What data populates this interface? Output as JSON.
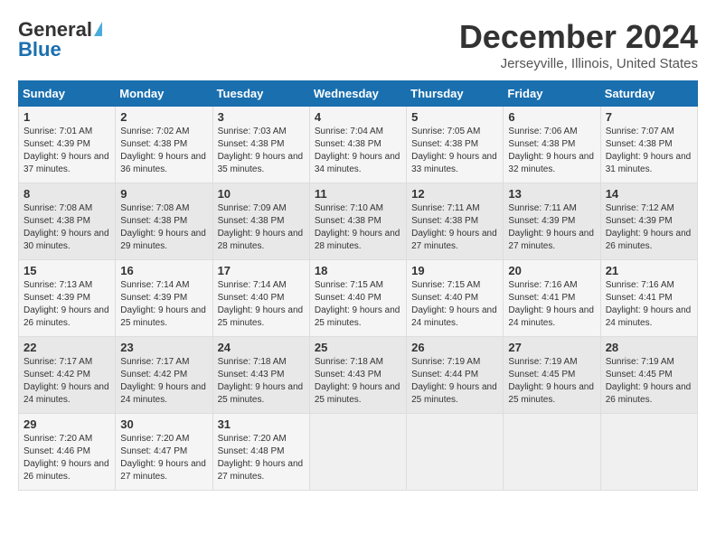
{
  "logo": {
    "general": "General",
    "blue": "Blue"
  },
  "title": "December 2024",
  "location": "Jerseyville, Illinois, United States",
  "days_of_week": [
    "Sunday",
    "Monday",
    "Tuesday",
    "Wednesday",
    "Thursday",
    "Friday",
    "Saturday"
  ],
  "weeks": [
    [
      {
        "day": "1",
        "sunrise": "Sunrise: 7:01 AM",
        "sunset": "Sunset: 4:39 PM",
        "daylight": "Daylight: 9 hours and 37 minutes."
      },
      {
        "day": "2",
        "sunrise": "Sunrise: 7:02 AM",
        "sunset": "Sunset: 4:38 PM",
        "daylight": "Daylight: 9 hours and 36 minutes."
      },
      {
        "day": "3",
        "sunrise": "Sunrise: 7:03 AM",
        "sunset": "Sunset: 4:38 PM",
        "daylight": "Daylight: 9 hours and 35 minutes."
      },
      {
        "day": "4",
        "sunrise": "Sunrise: 7:04 AM",
        "sunset": "Sunset: 4:38 PM",
        "daylight": "Daylight: 9 hours and 34 minutes."
      },
      {
        "day": "5",
        "sunrise": "Sunrise: 7:05 AM",
        "sunset": "Sunset: 4:38 PM",
        "daylight": "Daylight: 9 hours and 33 minutes."
      },
      {
        "day": "6",
        "sunrise": "Sunrise: 7:06 AM",
        "sunset": "Sunset: 4:38 PM",
        "daylight": "Daylight: 9 hours and 32 minutes."
      },
      {
        "day": "7",
        "sunrise": "Sunrise: 7:07 AM",
        "sunset": "Sunset: 4:38 PM",
        "daylight": "Daylight: 9 hours and 31 minutes."
      }
    ],
    [
      {
        "day": "8",
        "sunrise": "Sunrise: 7:08 AM",
        "sunset": "Sunset: 4:38 PM",
        "daylight": "Daylight: 9 hours and 30 minutes."
      },
      {
        "day": "9",
        "sunrise": "Sunrise: 7:08 AM",
        "sunset": "Sunset: 4:38 PM",
        "daylight": "Daylight: 9 hours and 29 minutes."
      },
      {
        "day": "10",
        "sunrise": "Sunrise: 7:09 AM",
        "sunset": "Sunset: 4:38 PM",
        "daylight": "Daylight: 9 hours and 28 minutes."
      },
      {
        "day": "11",
        "sunrise": "Sunrise: 7:10 AM",
        "sunset": "Sunset: 4:38 PM",
        "daylight": "Daylight: 9 hours and 28 minutes."
      },
      {
        "day": "12",
        "sunrise": "Sunrise: 7:11 AM",
        "sunset": "Sunset: 4:38 PM",
        "daylight": "Daylight: 9 hours and 27 minutes."
      },
      {
        "day": "13",
        "sunrise": "Sunrise: 7:11 AM",
        "sunset": "Sunset: 4:39 PM",
        "daylight": "Daylight: 9 hours and 27 minutes."
      },
      {
        "day": "14",
        "sunrise": "Sunrise: 7:12 AM",
        "sunset": "Sunset: 4:39 PM",
        "daylight": "Daylight: 9 hours and 26 minutes."
      }
    ],
    [
      {
        "day": "15",
        "sunrise": "Sunrise: 7:13 AM",
        "sunset": "Sunset: 4:39 PM",
        "daylight": "Daylight: 9 hours and 26 minutes."
      },
      {
        "day": "16",
        "sunrise": "Sunrise: 7:14 AM",
        "sunset": "Sunset: 4:39 PM",
        "daylight": "Daylight: 9 hours and 25 minutes."
      },
      {
        "day": "17",
        "sunrise": "Sunrise: 7:14 AM",
        "sunset": "Sunset: 4:40 PM",
        "daylight": "Daylight: 9 hours and 25 minutes."
      },
      {
        "day": "18",
        "sunrise": "Sunrise: 7:15 AM",
        "sunset": "Sunset: 4:40 PM",
        "daylight": "Daylight: 9 hours and 25 minutes."
      },
      {
        "day": "19",
        "sunrise": "Sunrise: 7:15 AM",
        "sunset": "Sunset: 4:40 PM",
        "daylight": "Daylight: 9 hours and 24 minutes."
      },
      {
        "day": "20",
        "sunrise": "Sunrise: 7:16 AM",
        "sunset": "Sunset: 4:41 PM",
        "daylight": "Daylight: 9 hours and 24 minutes."
      },
      {
        "day": "21",
        "sunrise": "Sunrise: 7:16 AM",
        "sunset": "Sunset: 4:41 PM",
        "daylight": "Daylight: 9 hours and 24 minutes."
      }
    ],
    [
      {
        "day": "22",
        "sunrise": "Sunrise: 7:17 AM",
        "sunset": "Sunset: 4:42 PM",
        "daylight": "Daylight: 9 hours and 24 minutes."
      },
      {
        "day": "23",
        "sunrise": "Sunrise: 7:17 AM",
        "sunset": "Sunset: 4:42 PM",
        "daylight": "Daylight: 9 hours and 24 minutes."
      },
      {
        "day": "24",
        "sunrise": "Sunrise: 7:18 AM",
        "sunset": "Sunset: 4:43 PM",
        "daylight": "Daylight: 9 hours and 25 minutes."
      },
      {
        "day": "25",
        "sunrise": "Sunrise: 7:18 AM",
        "sunset": "Sunset: 4:43 PM",
        "daylight": "Daylight: 9 hours and 25 minutes."
      },
      {
        "day": "26",
        "sunrise": "Sunrise: 7:19 AM",
        "sunset": "Sunset: 4:44 PM",
        "daylight": "Daylight: 9 hours and 25 minutes."
      },
      {
        "day": "27",
        "sunrise": "Sunrise: 7:19 AM",
        "sunset": "Sunset: 4:45 PM",
        "daylight": "Daylight: 9 hours and 25 minutes."
      },
      {
        "day": "28",
        "sunrise": "Sunrise: 7:19 AM",
        "sunset": "Sunset: 4:45 PM",
        "daylight": "Daylight: 9 hours and 26 minutes."
      }
    ],
    [
      {
        "day": "29",
        "sunrise": "Sunrise: 7:20 AM",
        "sunset": "Sunset: 4:46 PM",
        "daylight": "Daylight: 9 hours and 26 minutes."
      },
      {
        "day": "30",
        "sunrise": "Sunrise: 7:20 AM",
        "sunset": "Sunset: 4:47 PM",
        "daylight": "Daylight: 9 hours and 27 minutes."
      },
      {
        "day": "31",
        "sunrise": "Sunrise: 7:20 AM",
        "sunset": "Sunset: 4:48 PM",
        "daylight": "Daylight: 9 hours and 27 minutes."
      },
      null,
      null,
      null,
      null
    ]
  ]
}
